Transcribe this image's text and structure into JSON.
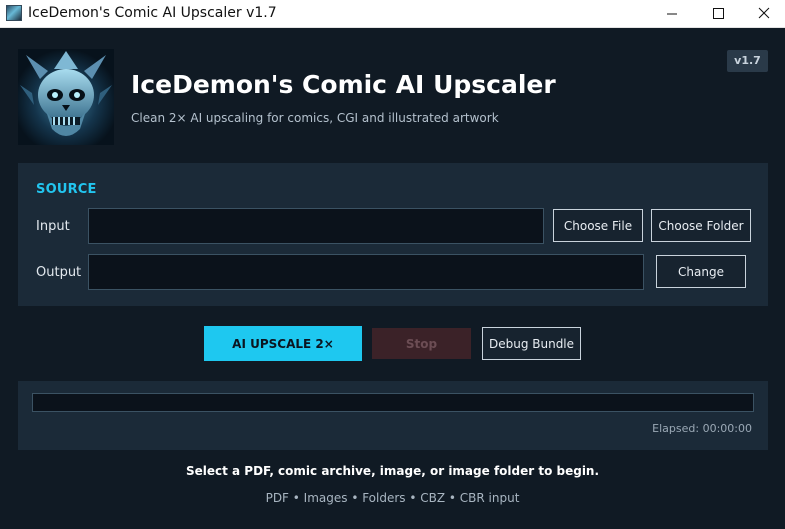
{
  "window": {
    "title": "IceDemon's Comic AI Upscaler v1.7",
    "icon": "app-skull-icon"
  },
  "header": {
    "title": "IceDemon's Comic AI Upscaler",
    "subtitle": "Clean 2× AI upscaling for comics, CGI and illustrated artwork",
    "version": "v1.7",
    "logo": "ice-demon-skull-logo"
  },
  "source": {
    "heading": "SOURCE",
    "input_label": "Input",
    "input_value": "",
    "output_label": "Output",
    "output_value": "",
    "choose_file_label": "Choose File",
    "choose_folder_label": "Choose Folder",
    "change_label": "Change"
  },
  "actions": {
    "upscale_label": "AI UPSCALE 2×",
    "stop_label": "Stop",
    "debug_label": "Debug Bundle"
  },
  "progress": {
    "percent": 0,
    "elapsed": "Elapsed: 00:00:00"
  },
  "status": {
    "message": "Select a PDF, comic archive, image, or image folder to begin.",
    "formats": "PDF • Images • Folders • CBZ • CBR input"
  },
  "colors": {
    "accent": "#1ec8f0",
    "background": "#101a24",
    "panel": "#1b2a38",
    "stop": "#3b2228"
  }
}
